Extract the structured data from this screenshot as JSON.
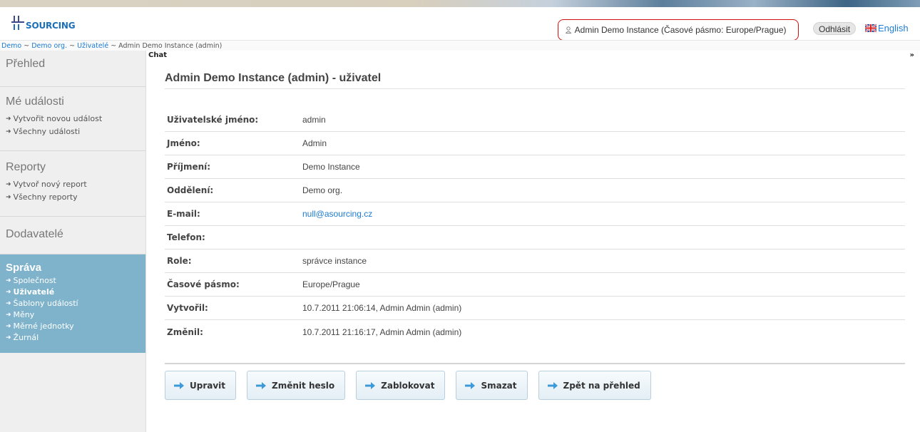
{
  "header": {
    "logo_text": "SOURCING",
    "user_info": "Admin Demo Instance (Časové pásmo: Europe/Prague)",
    "logout_label": "Odhlásit",
    "language_label": "English"
  },
  "breadcrumb": {
    "items": [
      "Demo",
      "Demo org.",
      "Uživatelé"
    ],
    "separator": " ~ ",
    "current": "Admin Demo Instance (admin)"
  },
  "sidebar": {
    "overview": "Přehled",
    "events": {
      "title": "Mé události",
      "links": [
        "Vytvořit novou událost",
        "Všechny události"
      ]
    },
    "reports": {
      "title": "Reporty",
      "links": [
        "Vytvoř nový report",
        "Všechny reporty"
      ]
    },
    "suppliers": "Dodavatelé",
    "admin": {
      "title": "Správa",
      "links": [
        "Společnost",
        "Uživatelé",
        "Šablony událostí",
        "Měny",
        "Měrné jednotky",
        "Žurnál"
      ],
      "active_index": 1
    }
  },
  "chat": {
    "label": "Chat",
    "toggle": "»"
  },
  "page": {
    "title": "Admin Demo Instance (admin) - uživatel"
  },
  "details": [
    {
      "label": "Uživatelské jméno:",
      "value": "admin"
    },
    {
      "label": "Jméno:",
      "value": "Admin"
    },
    {
      "label": "Příjmení:",
      "value": "Demo Instance"
    },
    {
      "label": "Oddělení:",
      "value": "Demo org."
    },
    {
      "label": "E-mail:",
      "value": "null@asourcing.cz"
    },
    {
      "label": "Telefon:",
      "value": ""
    },
    {
      "label": "Role:",
      "value": "správce instance"
    },
    {
      "label": "Časové pásmo:",
      "value": "Europe/Prague"
    },
    {
      "label": "Vytvořil:",
      "value": "10.7.2011 21:06:14, Admin Admin (admin)"
    },
    {
      "label": "Změnil:",
      "value": "10.7.2011 21:16:17, Admin Admin (admin)"
    }
  ],
  "actions": {
    "edit": "Upravit",
    "change_password": "Změnit heslo",
    "block": "Zablokovat",
    "delete": "Smazat",
    "back": "Zpět na přehled"
  },
  "colors": {
    "accent_blue": "#1b7bd2",
    "sidebar_active": "#7fb3cc",
    "highlight_border": "#d01010"
  },
  "icons": {
    "arrow": "arrow-right-icon",
    "user": "user-icon",
    "flag": "uk-flag-icon"
  }
}
